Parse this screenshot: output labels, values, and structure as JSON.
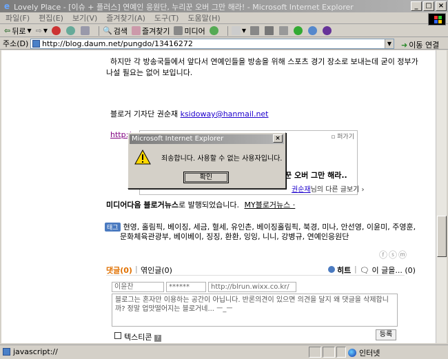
{
  "window": {
    "title": "Lovely Place - [이슈 + 플러스] 연예인 응원단, 누리꾼 오버 그만 해라! - Microsoft Internet Explorer"
  },
  "menu": [
    "파일(F)",
    "편집(E)",
    "보기(V)",
    "즐겨찾기(A)",
    "도구(T)",
    "도움말(H)"
  ],
  "toolbar": {
    "back": "뒤로",
    "search": "검색",
    "favorites": "즐겨찾기",
    "media": "미디어"
  },
  "address": {
    "label": "주소(D)",
    "url": "http://blog.daum.net/pungdo/13416272",
    "go": "이동",
    "links": "연결"
  },
  "article": {
    "line1": "하지만 각 방송국들에서 앞다서 연예인들을 방송을 위해 스포츠 경기 장소로 보내는데 굳이 정부가",
    "line2": "나설 필요는 없어 보입니다.",
    "byline_prefix": "블로거 기자단 권순재 ",
    "email": "ksidoway@hanmail.net",
    "link_partial": "http:/"
  },
  "widget": {
    "header": "퍼가기",
    "headline_partial": "꾼 오버 그만 해라..",
    "author_name": "권순재",
    "author_suffix": "님의 다른 글보기 ›"
  },
  "publish": {
    "brand": "미디어다음 블로거뉴스",
    "suffix": "로 발행되었습니다.",
    "my_link": "MY블로거뉴스 ·"
  },
  "tags": {
    "badge": "태그",
    "line1": "현영, 홀림픽, 베이징, 세금, 혈세, 유인촌, 베이징홀림픽, 북경, 미나, 안선영, 이윤미, 주영훈,",
    "line2": "문화체육관광부, 베이베이, 징징, 환환, 잉잉, 니니, 강병규, 연예인응원단"
  },
  "comments": {
    "comments_label": "댓글",
    "comments_count": "(0)",
    "trackback": "엮인글(0)",
    "hit": "히트",
    "this_post": "이 글을...",
    "this_post_count": "(0)"
  },
  "form": {
    "name_value": "이윤찬",
    "password_value": "******",
    "url_value": "http://blrun.wixx.co.kr/",
    "textarea_text": "블로그는 혼자만 이용하는 공간이 아닙니다. 반론의견이 있으면 의견을 달지 왜 댓글을 삭제합니까? 정말 업맛떨어지는 블로거네... ㅡ_ㅡ",
    "emoticon_label": "텍스티콘",
    "submit_label": "등록"
  },
  "dialog": {
    "title": "Microsoft Internet Explorer",
    "message": "죄송합니다. 사용할 수 없는 사용자입니다.",
    "ok_label": "확인"
  },
  "status": {
    "text": "javascript://",
    "zone": "인터넷"
  }
}
